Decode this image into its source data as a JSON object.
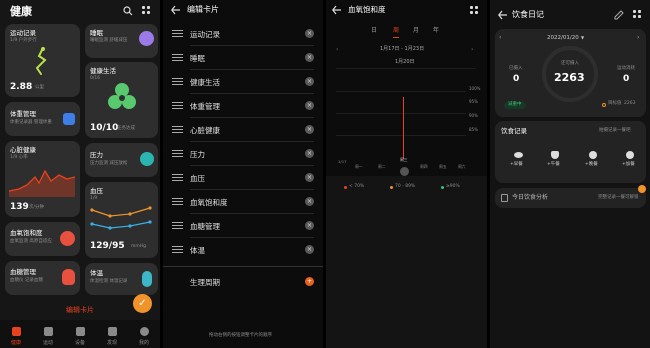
{
  "screen1": {
    "title": "健康",
    "cards": {
      "exercise": {
        "title": "运动记录",
        "sub": "1/9 户外步行",
        "value": "2.88",
        "unit": "公里"
      },
      "sleep": {
        "title": "睡眠",
        "sub": "睡眠监测 舒缓减压"
      },
      "healthy_living": {
        "title": "健康生活",
        "sub": "0/16",
        "value": "10/10",
        "unit": "任务达成"
      },
      "weight": {
        "title": "体重管理",
        "sub": "体重记录器 管理体重"
      },
      "heart": {
        "title": "心脏健康",
        "sub": "1/9 心率",
        "value": "139",
        "unit": "次/分钟"
      },
      "stress": {
        "title": "压力",
        "sub": "压力监测 减压放松"
      },
      "blood_pressure": {
        "title": "血压",
        "sub": "1/9",
        "value": "129/95",
        "unit": "mmHg"
      },
      "spo2": {
        "title": "血氧饱和度",
        "sub": "血氧监测 高原自适应"
      },
      "glucose": {
        "title": "血糖管理",
        "sub": "血糖仪 记录血糖"
      },
      "temperature": {
        "title": "体温",
        "sub": "体温检测 体温记录"
      }
    },
    "edit_cards_label": "编辑卡片",
    "tabs": [
      "健康",
      "运动",
      "设备",
      "发现",
      "我的"
    ]
  },
  "screen2": {
    "title": "编辑卡片",
    "items": [
      "运动记录",
      "睡眠",
      "健康生活",
      "体重管理",
      "心脏健康",
      "压力",
      "血压",
      "血氧饱和度",
      "血糖管理",
      "体温"
    ],
    "extra_item": "生理周期",
    "footer": "拖动右侧的按钮调整卡片的顺序",
    "remove_symbol": "×",
    "add_symbol": "+"
  },
  "screen3": {
    "title": "血氧饱和度",
    "tabs": [
      "日",
      "周",
      "月",
      "年"
    ],
    "active_tab": "周",
    "range": "1月17日 - 1月23日",
    "selected_date": "1月20日",
    "y_ticks": [
      "100%",
      "95%",
      "90%",
      "85%"
    ],
    "x_ticks": [
      "1/17",
      "周一",
      "周二",
      "周三",
      "周四",
      "周五",
      "周六"
    ],
    "legend": [
      "< 70%",
      "70 - 89%",
      "≥90%"
    ]
  },
  "screen4": {
    "title": "饮食日记",
    "date": "2022/01/20",
    "intake_label": "已摄入",
    "intake_value": "0",
    "remaining_label": "还可摄入",
    "remaining_value": "2263",
    "burn_label": "运动消耗",
    "burn_value": "0",
    "badge": "减重中",
    "goal_label": "目标值",
    "goal_value": "2263",
    "record_title": "饮食记录",
    "record_hint": "拍摄记录一餐吧",
    "meals": [
      "+早餐",
      "+午餐",
      "+晚餐",
      "+加餐"
    ],
    "analysis": "今日饮食分析",
    "analysis_hint": "完整记录一餐可解锁"
  },
  "colors": {
    "accent": "#e8411e",
    "orange": "#f0932b",
    "green": "#3fbf7a",
    "blue": "#3e7ee8",
    "teal": "#2bb5b0"
  }
}
